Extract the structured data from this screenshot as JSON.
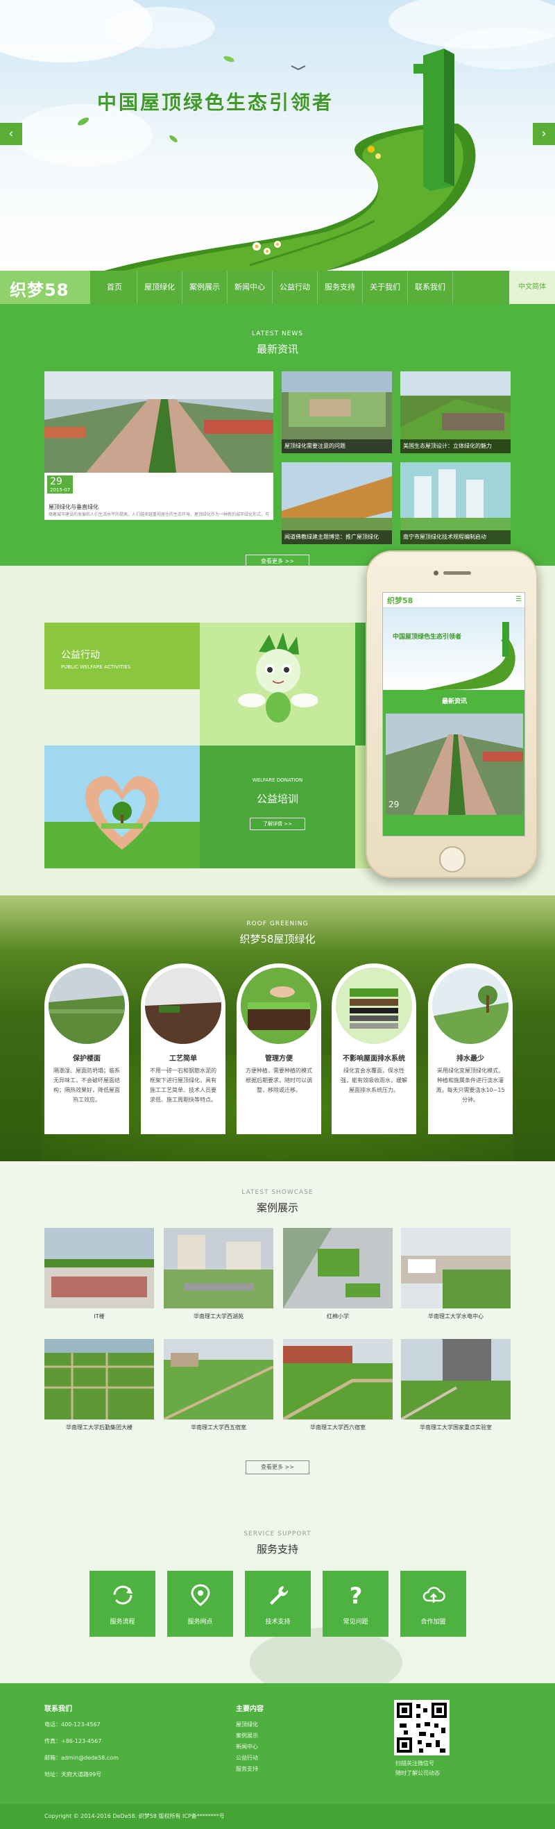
{
  "banner": {
    "title": "中国屋顶绿色生态引领者",
    "prev_icon": "chevron-left-icon",
    "next_icon": "chevron-right-icon"
  },
  "nav": {
    "logo": "织梦58",
    "items": [
      "首页",
      "屋顶绿化",
      "案例展示",
      "新闻中心",
      "公益行动",
      "服务支持",
      "关于我们",
      "联系我们"
    ],
    "lang": "中文简体"
  },
  "news": {
    "title_en": "LATEST NEWS",
    "title_cn": "最新资讯",
    "featured": {
      "day": "29",
      "month": "2015-07",
      "title": "屋顶绿化与垂直绿化",
      "summary": "随着城市建设的发展和人们生活水平的提高，人们越来越重视居住的生态环境，屋顶绿化作为一种新的城市绿化形式，可以有效改善城市生态环境。"
    },
    "items": [
      "屋顶绿化需要注意的问题",
      "美国生态屋顶设计：立体绿化的魅力",
      "闻道佛教绿建主题博览：推广屋顶绿化",
      "南宁市屋顶绿化技术规程编制启动"
    ],
    "more": "查看更多 >>"
  },
  "welfare": {
    "box1_cn": "公益行动",
    "box1_en": "PUBLIC WELFARE ACTIVITIES",
    "box2_en": "WELFARE DONATION",
    "box2_cn": "公益培训",
    "box2_btn": "了解详情 >>"
  },
  "phone": {
    "logo": "织梦58",
    "banner_text": "中国屋顶绿色生态引领者",
    "news_label": "最新资讯",
    "news_day": "29"
  },
  "roof": {
    "title_en": "ROOF GREENING",
    "title_cn": "织梦58屋顶绿化",
    "cards": [
      {
        "title": "保护楼面",
        "desc": "隔潮湿、屋面防坍塌；临系无异味工，不会破坏屋面结构；隔热效果好，降低屋面热工效应。"
      },
      {
        "title": "工艺简单",
        "desc": "不用一砖一石和钢筋水泥的框架下进行屋顶绿化，具有施工工艺简单、技术人员要求低、施工周期快等特点。"
      },
      {
        "title": "管理方便",
        "desc": "方便种植，需要种植的模式根据后期要求，随时可以调整，移除或迁移。"
      },
      {
        "title": "不影响屋面排水系统",
        "desc": "绿化宜会水覆面，保水性强，能有效吸收雨水，缓解屋面排水系统压力。"
      },
      {
        "title": "排水最少",
        "desc": "采用绿化宜屋顶绿化模式，种植和施属条件进行浇水灌溉，每天只需要浇水10~15分钟。"
      }
    ]
  },
  "cases": {
    "title_en": "LATEST SHOWCASE",
    "title_cn": "案例展示",
    "items": [
      "IT楼",
      "华南理工大学西湖苑",
      "红棉小学",
      "华南理工大学水电中心",
      "华南理工大学后勤集团大楼",
      "华南理工大学西五宿室",
      "华南理工大学西六宿室",
      "华南理工大学国家重点实验室"
    ],
    "more": "查看更多 >>"
  },
  "service": {
    "title_en": "SERVICE SUPPORT",
    "title_cn": "服务支持",
    "items": [
      {
        "label": "服务流程",
        "icon": "refresh-icon"
      },
      {
        "label": "服务网点",
        "icon": "location-pin-icon"
      },
      {
        "label": "技术支持",
        "icon": "wrench-icon"
      },
      {
        "label": "常见问题",
        "icon": "question-mark-icon"
      },
      {
        "label": "合作加盟",
        "icon": "cloud-upload-icon"
      }
    ]
  },
  "footer": {
    "contact_title": "联系我们",
    "phone": "电话：400-123-4567",
    "fax": "传真：+86-123-4567",
    "email": "邮箱：admin@dede58.com",
    "address": "地址：天府大道路99号",
    "menu_title": "主要内容",
    "menu": [
      "屋顶绿化",
      "案例展示",
      "新闻中心",
      "公益行动",
      "服务支持"
    ],
    "qr_text1": "扫描关注微信号",
    "qr_text2": "随时了解公司动态",
    "copyright": "Copyright © 2014-2016 DeDe58. 织梦58 版权所有    ICP备********号"
  },
  "colors": {
    "brand_green": "#58b03b",
    "light_green": "#8fd16a",
    "footer_green": "#4eb03f"
  }
}
